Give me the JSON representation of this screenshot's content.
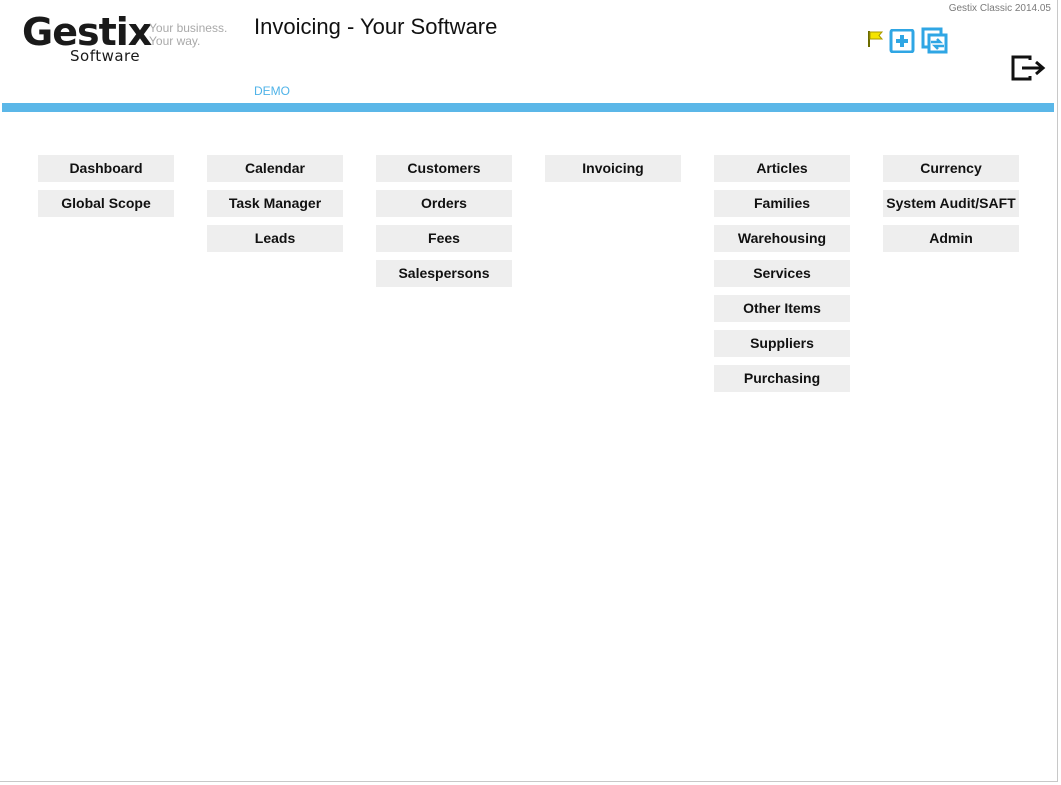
{
  "header": {
    "version": "Gestix Classic 2014.05",
    "logo_word": "Gestix",
    "logo_sub": "Software",
    "logo_tagline_1": "Your business.",
    "logo_tagline_2": "Your way.",
    "title": "Invoicing - Your Software",
    "environment": "DEMO"
  },
  "icons": {
    "flag": "flag-icon",
    "add": "plus-square-icon",
    "refresh": "refresh-icon",
    "logout": "logout-icon",
    "flag_color": "#f5e400",
    "accent_color": "#2fa6e4"
  },
  "theme": {
    "bar_color": "#5bb7e8",
    "button_bg": "#eeeeee"
  },
  "menu": {
    "columns": [
      [
        "Dashboard",
        "Global Scope"
      ],
      [
        "Calendar",
        "Task Manager",
        "Leads"
      ],
      [
        "Customers",
        "Orders",
        "Fees",
        "Salespersons"
      ],
      [
        "Invoicing"
      ],
      [
        "Articles",
        "Families",
        "Warehousing",
        "Services",
        "Other Items",
        "Suppliers",
        "Purchasing"
      ],
      [
        "Currency",
        "System Audit/SAFT",
        "Admin"
      ]
    ]
  }
}
